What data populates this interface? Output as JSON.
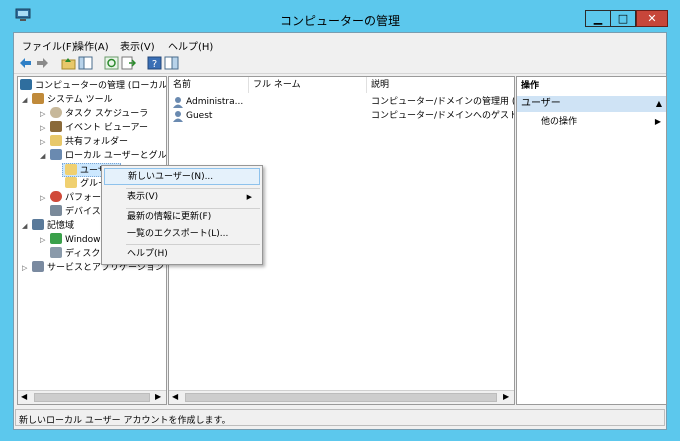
{
  "window": {
    "title": "コンピューターの管理"
  },
  "menu": [
    "ファイル(F)",
    "操作(A)",
    "表示(V)",
    "ヘルプ(H)"
  ],
  "tree": {
    "root": "コンピューターの管理 (ローカル)",
    "system_tools": "システム ツール",
    "task_scheduler": "タスク スケジューラ",
    "event_viewer": "イベント ビューアー",
    "shared_folders": "共有フォルダー",
    "local_users_groups": "ローカル ユーザーとグループ",
    "users": "ユーザー",
    "groups": "グループ",
    "performance": "パフォーマンス",
    "device_manager": "デバイス マネージャー",
    "storage": "記憶域",
    "windows_backup": "Windows Server バックアップ",
    "disk_management": "ディスクの管理",
    "services_apps": "サービスとアプリケーション"
  },
  "list": {
    "columns": [
      "名前",
      "フル ネーム",
      "説明"
    ],
    "rows": [
      {
        "name": "Administra...",
        "fullname": "",
        "description": "コンピューター/ドメインの管理用 (ビル..."
      },
      {
        "name": "Guest",
        "fullname": "",
        "description": "コンピューター/ドメインへのゲスト アク..."
      }
    ]
  },
  "actions": {
    "header": "操作",
    "section": "ユーザー",
    "more": "他の操作"
  },
  "context_menu": {
    "new_user": "新しいユーザー(N)...",
    "view": "表示(V)",
    "refresh": "最新の情報に更新(F)",
    "export": "一覧のエクスポート(L)...",
    "help": "ヘルプ(H)"
  },
  "status": "新しいローカル ユーザー アカウントを作成します。",
  "colors": {
    "frame": "#5cc8ed",
    "close": "#c7463a",
    "highlight": "#cce8ff",
    "section": "#cfe3f5"
  }
}
